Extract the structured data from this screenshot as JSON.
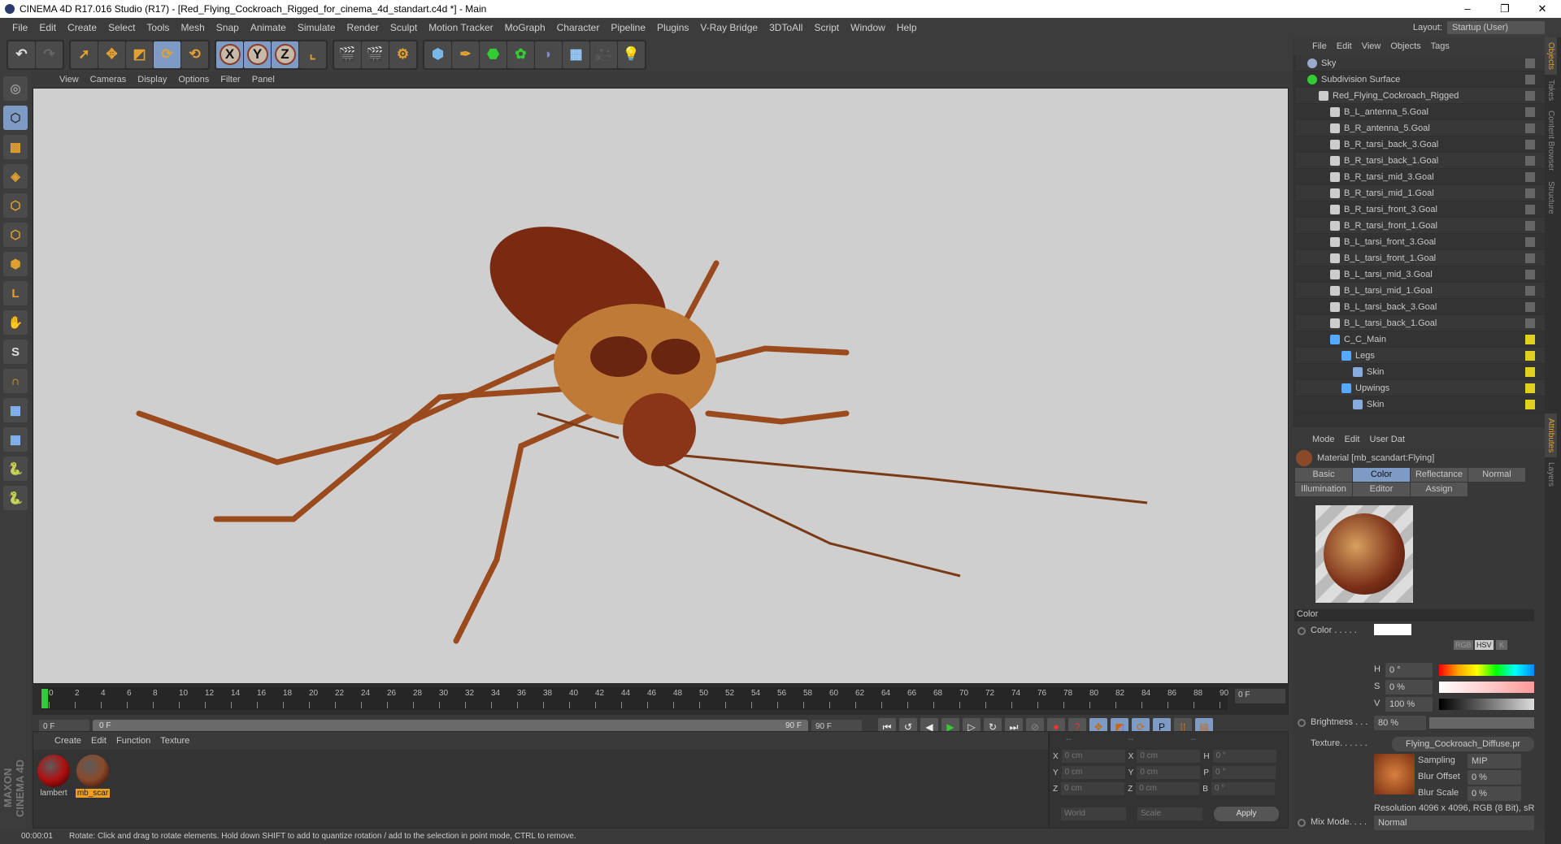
{
  "title": "CINEMA 4D R17.016 Studio (R17) - [Red_Flying_Cockroach_Rigged_for_cinema_4d_standart.c4d *] - Main",
  "window_controls": [
    "–",
    "❐",
    "✕"
  ],
  "menu": [
    "File",
    "Edit",
    "Create",
    "Select",
    "Tools",
    "Mesh",
    "Snap",
    "Animate",
    "Simulate",
    "Render",
    "Sculpt",
    "Motion Tracker",
    "MoGraph",
    "Character",
    "Pipeline",
    "Plugins",
    "V-Ray Bridge",
    "3DToAll",
    "Script",
    "Window",
    "Help"
  ],
  "layout": {
    "label": "Layout:",
    "value": "Startup (User)"
  },
  "viewport_menu": [
    "View",
    "Cameras",
    "Display",
    "Options",
    "Filter",
    "Panel"
  ],
  "timeline": {
    "ticks": [
      0,
      2,
      4,
      6,
      8,
      10,
      12,
      14,
      16,
      18,
      20,
      22,
      24,
      26,
      28,
      30,
      32,
      34,
      36,
      38,
      40,
      42,
      44,
      46,
      48,
      50,
      52,
      54,
      56,
      58,
      60,
      62,
      64,
      66,
      68,
      70,
      72,
      74,
      76,
      78,
      80,
      82,
      84,
      86,
      88,
      90
    ],
    "current": "0 F",
    "start": "0 F",
    "range_start": "0 F",
    "range_end": "90 F",
    "end": "90 F"
  },
  "material_menu": [
    "Create",
    "Edit",
    "Function",
    "Texture"
  ],
  "materials": [
    {
      "name": "lambert",
      "color": "#b01010"
    },
    {
      "name": "mb_scar",
      "color": "#8a4a2a"
    }
  ],
  "coords": {
    "headers": [
      "--",
      "--",
      "--"
    ],
    "rows": [
      [
        "X",
        "0 cm",
        "X",
        "0 cm",
        "H",
        "0 °"
      ],
      [
        "Y",
        "0 cm",
        "Y",
        "0 cm",
        "P",
        "0 °"
      ],
      [
        "Z",
        "0 cm",
        "Z",
        "0 cm",
        "B",
        "0 °"
      ]
    ],
    "world": "World",
    "scale": "Scale",
    "apply": "Apply"
  },
  "status": {
    "time": "00:00:01",
    "message": "Rotate: Click and drag to rotate elements. Hold down SHIFT to add to quantize rotation / add to the selection in point mode, CTRL to remove."
  },
  "maxon_logo": "MAXON CINEMA 4D",
  "object_menu": [
    "File",
    "Edit",
    "View",
    "Objects",
    "Tags"
  ],
  "objects": [
    {
      "name": "Sky",
      "indent": 0,
      "icon": "sky",
      "tag": "grey"
    },
    {
      "name": "Subdivision Surface",
      "indent": 0,
      "icon": "subdiv",
      "tag": "grey"
    },
    {
      "name": "Red_Flying_Cockroach_Rigged",
      "indent": 1,
      "icon": "null",
      "tag": "grey"
    },
    {
      "name": "B_L_antenna_5.Goal",
      "indent": 2,
      "icon": "null",
      "tag": "grey"
    },
    {
      "name": "B_R_antenna_5.Goal",
      "indent": 2,
      "icon": "null",
      "tag": "grey"
    },
    {
      "name": "B_R_tarsi_back_3.Goal",
      "indent": 2,
      "icon": "null",
      "tag": "grey"
    },
    {
      "name": "B_R_tarsi_back_1.Goal",
      "indent": 2,
      "icon": "null",
      "tag": "grey"
    },
    {
      "name": "B_R_tarsi_mid_3.Goal",
      "indent": 2,
      "icon": "null",
      "tag": "grey"
    },
    {
      "name": "B_R_tarsi_mid_1.Goal",
      "indent": 2,
      "icon": "null",
      "tag": "grey"
    },
    {
      "name": "B_R_tarsi_front_3.Goal",
      "indent": 2,
      "icon": "null",
      "tag": "grey"
    },
    {
      "name": "B_R_tarsi_front_1.Goal",
      "indent": 2,
      "icon": "null",
      "tag": "grey"
    },
    {
      "name": "B_L_tarsi_front_3.Goal",
      "indent": 2,
      "icon": "null",
      "tag": "grey"
    },
    {
      "name": "B_L_tarsi_front_1.Goal",
      "indent": 2,
      "icon": "null",
      "tag": "grey"
    },
    {
      "name": "B_L_tarsi_mid_3.Goal",
      "indent": 2,
      "icon": "null",
      "tag": "grey"
    },
    {
      "name": "B_L_tarsi_mid_1.Goal",
      "indent": 2,
      "icon": "null",
      "tag": "grey"
    },
    {
      "name": "B_L_tarsi_back_3.Goal",
      "indent": 2,
      "icon": "null",
      "tag": "grey"
    },
    {
      "name": "B_L_tarsi_back_1.Goal",
      "indent": 2,
      "icon": "null",
      "tag": "grey"
    },
    {
      "name": "C_C_Main",
      "indent": 2,
      "icon": "joint",
      "tag": "yellow"
    },
    {
      "name": "Legs",
      "indent": 3,
      "icon": "joint",
      "tag": "yellow"
    },
    {
      "name": "Skin",
      "indent": 4,
      "icon": "skin",
      "tag": "yellow"
    },
    {
      "name": "Upwings",
      "indent": 3,
      "icon": "joint",
      "tag": "yellow"
    },
    {
      "name": "Skin",
      "indent": 4,
      "icon": "skin",
      "tag": "yellow"
    }
  ],
  "side_tabs": [
    "Objects",
    "Takes",
    "Content Browser",
    "Structure",
    "Attributes",
    "Layers"
  ],
  "attr_menu": [
    "Mode",
    "Edit",
    "User Dat"
  ],
  "attributes": {
    "material_title": "Material [mb_scandart:Flying]",
    "tabs": [
      "Basic",
      "Color",
      "Reflectance",
      "Normal",
      "Illumination",
      "Editor",
      "Assign"
    ],
    "active_tab": "Color",
    "section": "Color",
    "color_label": "Color . . . . .",
    "color_modes": [
      "RGB",
      "HSV",
      "K"
    ],
    "h_label": "H",
    "h": "0 °",
    "s_label": "S",
    "s": "0 %",
    "v_label": "V",
    "v": "100 %",
    "brightness_label": "Brightness . . .",
    "brightness": "80 %",
    "texture_label": "Texture. . . . . .",
    "texture": "Flying_Cockroach_Diffuse.pr",
    "sampling_label": "Sampling",
    "sampling": "MIP",
    "blur_offset_label": "Blur Offset",
    "blur_offset": "0 %",
    "blur_scale_label": "Blur Scale",
    "blur_scale": "0 %",
    "resolution": "Resolution 4096 x 4096, RGB (8 Bit), sR(",
    "mix_label": "Mix Mode. . . .",
    "mix": "Normal"
  }
}
